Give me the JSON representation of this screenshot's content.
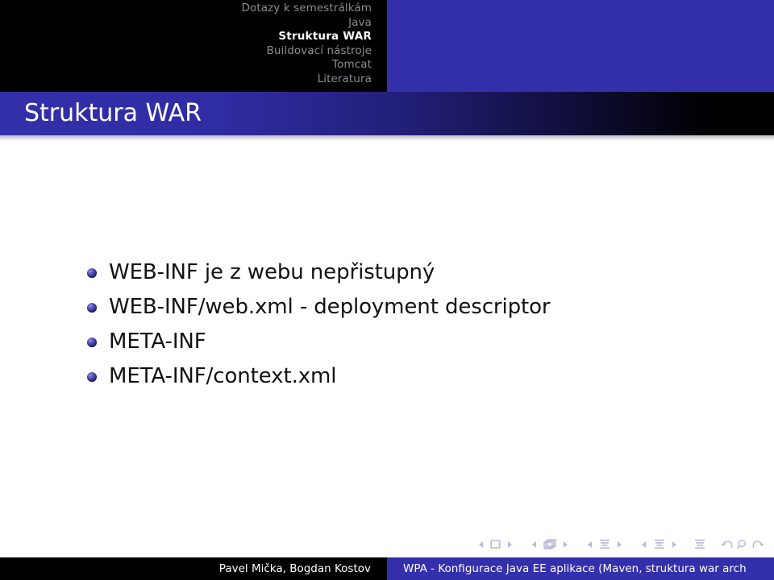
{
  "header": {
    "nav_items": [
      {
        "label": "Dotazy k semestrálkám",
        "active": false
      },
      {
        "label": "Java",
        "active": false
      },
      {
        "label": "Struktura WAR",
        "active": true
      },
      {
        "label": "Buildovací nástroje",
        "active": false
      },
      {
        "label": "Tomcat",
        "active": false
      },
      {
        "label": "Literatura",
        "active": false
      }
    ],
    "accent_color": "#3430ab",
    "dark_color": "#000000"
  },
  "title": {
    "text": "Struktura WAR"
  },
  "slide": {
    "bullets": [
      "WEB-INF je z webu nepřistupný",
      "WEB-INF/web.xml - deployment descriptor",
      "META-INF",
      "META-INF/context.xml"
    ],
    "bullet_color": "#3a3a9e",
    "text_color": "#111111"
  },
  "navsymbols": {
    "color": "#b9b9da",
    "groups": [
      {
        "name": "slide-navigation",
        "icons": [
          "prev-slide-triangle-icon",
          "slide-square-icon",
          "next-slide-triangle-icon"
        ]
      },
      {
        "name": "frame-navigation",
        "icons": [
          "prev-frame-triangle-icon",
          "frame-stack-icon",
          "next-frame-triangle-icon"
        ]
      },
      {
        "name": "subsection-navigation",
        "icons": [
          "prev-subsection-triangle-icon",
          "subsection-lines-icon",
          "next-subsection-triangle-icon"
        ]
      },
      {
        "name": "section-navigation",
        "icons": [
          "prev-section-triangle-icon",
          "section-lines-icon",
          "next-section-triangle-icon"
        ]
      },
      {
        "name": "presentation-navigation",
        "icons": [
          "document-lines-icon"
        ]
      },
      {
        "name": "history-navigation",
        "icons": [
          "back-arrow-icon",
          "search-icon",
          "forward-arrow-icon"
        ]
      }
    ]
  },
  "footer": {
    "authors": "Pavel Mička, Bogdan Kostov",
    "presentation_title": "WPA - Konfigurace Java EE aplikace (Maven, struktura war arch"
  }
}
